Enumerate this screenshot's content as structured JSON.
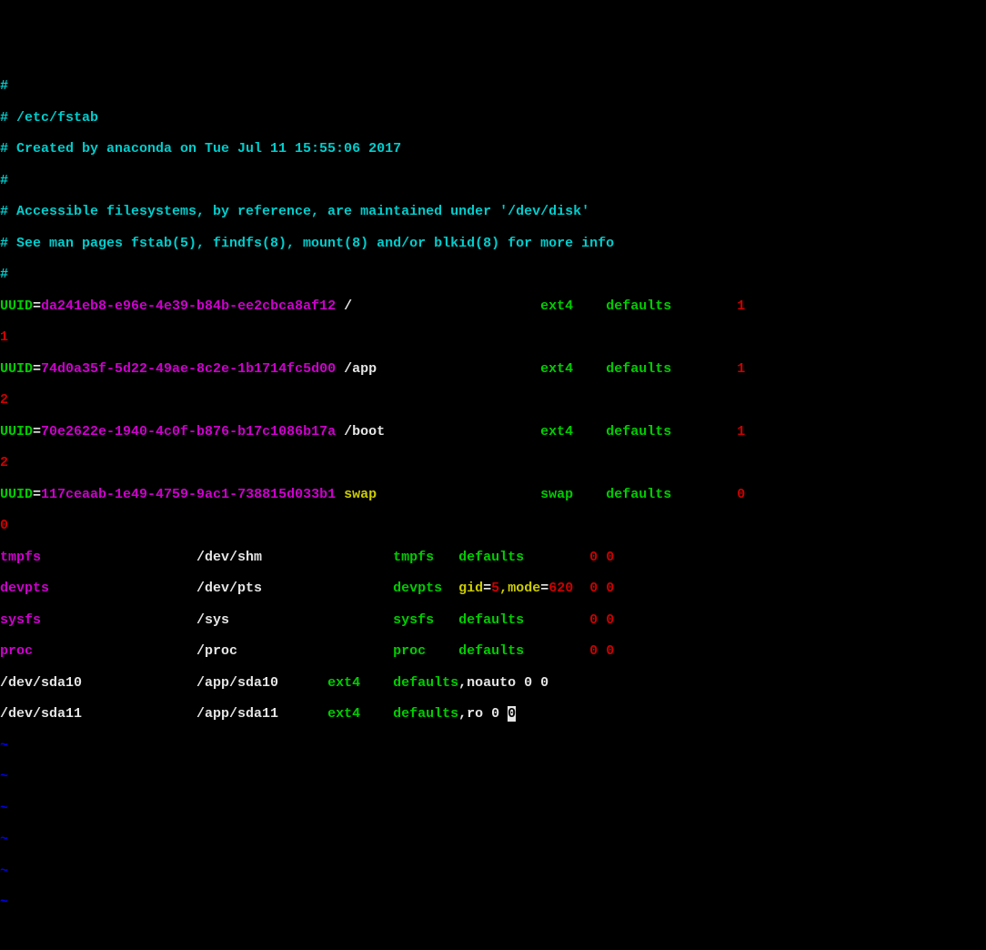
{
  "comments": {
    "l1": "#",
    "l2": "# /etc/fstab",
    "l3": "# Created by anaconda on Tue Jul 11 15:55:06 2017",
    "l4": "#",
    "l5": "# Accessible filesystems, by reference, are maintained under '/dev/disk'",
    "l6": "# See man pages fstab(5), findfs(8), mount(8) and/or blkid(8) for more info",
    "l7": "#"
  },
  "uuid_entries": [
    {
      "uuid_kw": "UUID",
      "uuid_val": "da241eb8-e96e-4e39-b84b-ee2cbca8af12",
      "mount": "/",
      "fs": "ext4",
      "opts": "defaults",
      "dump": "1",
      "pass": "1"
    },
    {
      "uuid_kw": "UUID",
      "uuid_val": "74d0a35f-5d22-49ae-8c2e-1b1714fc5d00",
      "mount": "/app",
      "fs": "ext4",
      "opts": "defaults",
      "dump": "1",
      "pass": "2"
    },
    {
      "uuid_kw": "UUID",
      "uuid_val": "70e2622e-1940-4c0f-b876-b17c1086b17a",
      "mount": "/boot",
      "fs": "ext4",
      "opts": "defaults",
      "dump": "1",
      "pass": "2"
    },
    {
      "uuid_kw": "UUID",
      "uuid_val": "117ceaab-1e49-4759-9ac1-738815d033b1",
      "mount": "swap",
      "fs": "swap",
      "opts": "defaults",
      "dump": "0",
      "pass": "0"
    }
  ],
  "plain_entries": [
    {
      "dev": "tmpfs",
      "mount": "/dev/shm",
      "fs": "tmpfs",
      "opts": "defaults",
      "dump": "0",
      "pass": "0"
    },
    {
      "dev": "devpts",
      "mount": "/dev/pts",
      "fs": "devpts",
      "opts_pre": "gid",
      "opts_eq1": "=",
      "opts_val1": "5",
      "opts_comma": ",",
      "opts_mode": "mode",
      "opts_eq2": "=",
      "opts_val2": "620",
      "dump": "0",
      "pass": "0"
    },
    {
      "dev": "sysfs",
      "mount": "/sys",
      "fs": "sysfs",
      "opts": "defaults",
      "dump": "0",
      "pass": "0"
    },
    {
      "dev": "proc",
      "mount": "/proc",
      "fs": "proc",
      "opts": "defaults",
      "dump": "0",
      "pass": "0"
    }
  ],
  "sda_entries": [
    {
      "dev": "/dev/sda10",
      "mount": "/app/sda10",
      "fs": "ext4",
      "opts": "defaults",
      "opts2": ",noauto 0 0"
    },
    {
      "dev": "/dev/sda11",
      "mount": "/app/sda11",
      "fs": "ext4",
      "opts": "defaults",
      "opts2": ",ro 0 ",
      "cursor": "0"
    }
  ],
  "tilde": "~"
}
